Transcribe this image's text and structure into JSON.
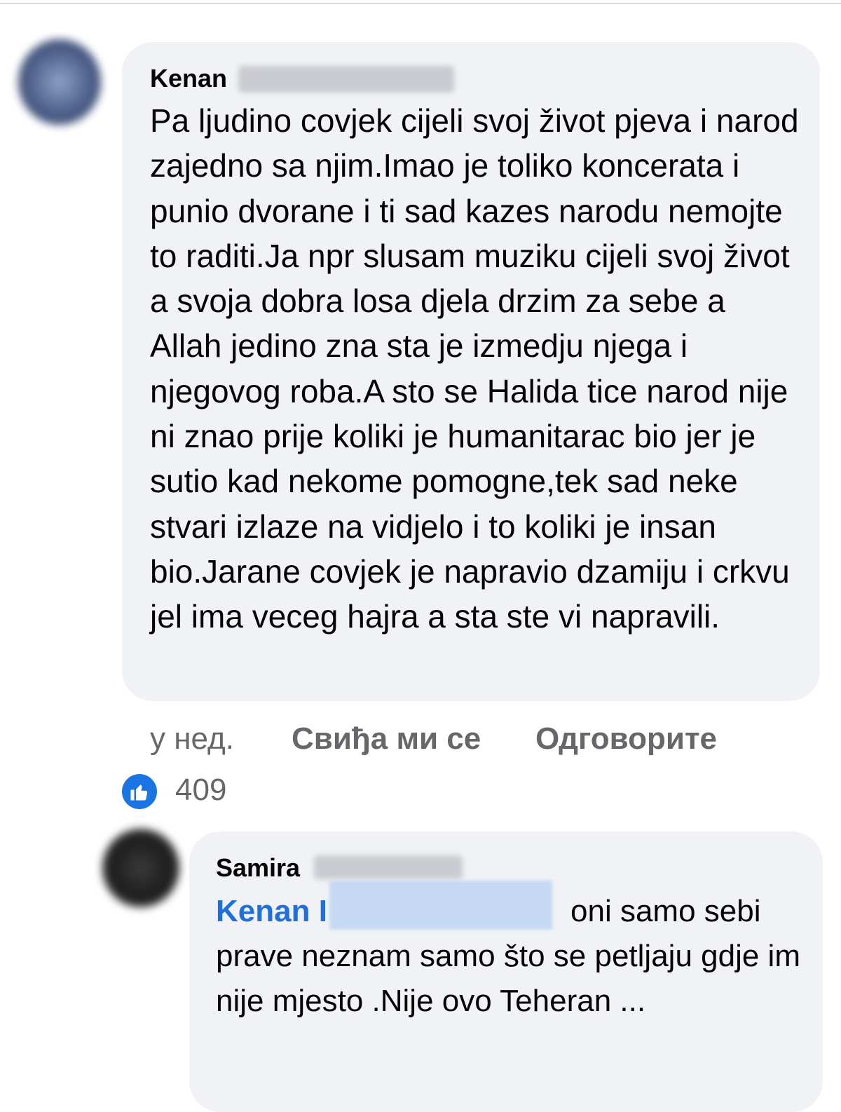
{
  "comment": {
    "author_first_name": "Kenan",
    "text": "Pa ljudino covjek cijeli svoj život pjeva i narod zajedno sa njim.Imao je toliko koncerata i punio dvorane i ti sad kazes narodu nemojte to raditi.Ja npr slusam muziku cijeli svoj život a svoja dobra losa djela drzim za sebe a Allah jedino zna sta je izmedju njega i njegovog roba.A sto se Halida tice narod nije ni znao prije koliki je humanitarac bio jer je sutio kad nekome pomogne,tek sad neke stvari izlaze na vidjelo i to koliki je insan bio.Jarane covjek je napravio dzamiju i crkvu jel ima veceg hajra a sta ste vi napravili.",
    "time": "у нед.",
    "like_label": "Свиђа ми се",
    "reply_label": "Одговорите",
    "reaction_count": "409"
  },
  "reply": {
    "author_first_name": "Samira",
    "mention_name": "Kenan I",
    "first_line": "oni samo sebi",
    "text_rest": "prave neznam samo što se petljaju gdje im nije mjesto .Nije ovo Teheran ..."
  },
  "colors": {
    "bubble_bg": "#f0f2f5",
    "meta_text": "#65676b",
    "mention_link": "#216fdb",
    "like_icon_bg": "#1b74e4"
  }
}
